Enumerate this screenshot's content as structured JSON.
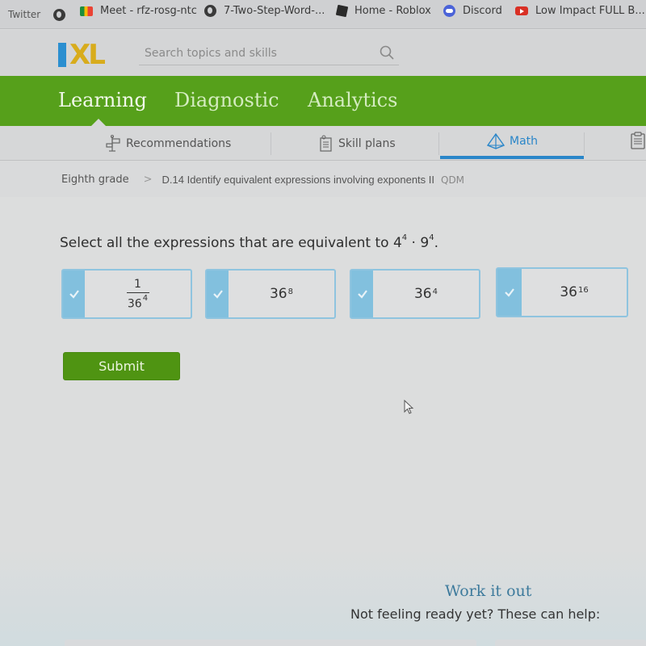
{
  "bookmarks": [
    {
      "label": "Twitter",
      "icon": "none"
    },
    {
      "label": "",
      "icon": "globe-icon"
    },
    {
      "label": "Meet - rfz-rosg-ntc",
      "icon": "google-meet-icon"
    },
    {
      "label": "7-Two-Step-Word-...",
      "icon": "globe-icon"
    },
    {
      "label": "Home - Roblox",
      "icon": "roblox-icon"
    },
    {
      "label": "Discord",
      "icon": "discord-icon"
    },
    {
      "label": "Low Impact FULL B...",
      "icon": "youtube-icon"
    }
  ],
  "header": {
    "logo_i": "I",
    "logo_xl": "XL",
    "search_placeholder": "Search topics and skills"
  },
  "nav": {
    "tabs": [
      {
        "label": "Learning",
        "active": true
      },
      {
        "label": "Diagnostic",
        "active": false
      },
      {
        "label": "Analytics",
        "active": false
      }
    ]
  },
  "subnav": {
    "tabs": [
      {
        "label": "Recommendations",
        "icon": "signpost-icon",
        "active": false
      },
      {
        "label": "Skill plans",
        "icon": "checklist-icon",
        "active": false
      },
      {
        "label": "Math",
        "icon": "pyramid-icon",
        "active": true
      }
    ]
  },
  "breadcrumb": {
    "grade": "Eighth grade",
    "separator": ">",
    "skill": "D.14 Identify equivalent expressions involving exponents II",
    "code": "QDM"
  },
  "question": {
    "prompt": "Select all the expressions that are equivalent to",
    "base1": "4",
    "exp1": "4",
    "dot": "·",
    "base2": "9",
    "exp2": "4",
    "end": "."
  },
  "choices": [
    {
      "type": "fraction",
      "numerator": "1",
      "base": "36",
      "exponent": "4",
      "selected": true
    },
    {
      "type": "power",
      "base": "36",
      "exponent": "8",
      "selected": true
    },
    {
      "type": "power",
      "base": "36",
      "exponent": "4",
      "selected": true
    },
    {
      "type": "power",
      "base": "36",
      "exponent": "16",
      "selected": true
    }
  ],
  "submit_label": "Submit",
  "help": {
    "title": "Work it out",
    "subtitle": "Not feeling ready yet? These can help:"
  },
  "colors": {
    "brand_green": "#56a01b",
    "submit_green": "#4f9412",
    "accent_blue": "#2a86c9",
    "choice_selected": "#82c0de",
    "logo_blue": "#2b8fd0",
    "logo_yellow": "#d8ac1c"
  }
}
